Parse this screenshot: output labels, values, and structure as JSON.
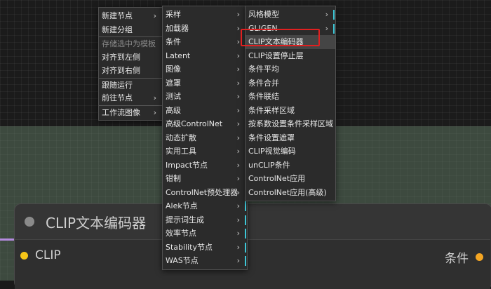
{
  "node": {
    "title": "CLIP文本编码器",
    "input_label": "CLIP",
    "output_label": "条件"
  },
  "menu_main": {
    "items": [
      {
        "label": "新建节点",
        "arrow": "›",
        "bar": false,
        "disabled": false,
        "sep": false
      },
      {
        "label": "新建分组",
        "arrow": "",
        "bar": false,
        "disabled": false,
        "sep": false
      },
      {
        "label": "存储选中为模板",
        "arrow": "",
        "bar": false,
        "disabled": true,
        "sep": true
      },
      {
        "label": "对齐到左侧",
        "arrow": "",
        "bar": false,
        "disabled": false,
        "sep": false
      },
      {
        "label": "对齐到右侧",
        "arrow": "",
        "bar": false,
        "disabled": false,
        "sep": false
      },
      {
        "label": "跟随运行",
        "arrow": "",
        "bar": false,
        "disabled": false,
        "sep": true
      },
      {
        "label": "前往节点",
        "arrow": "›",
        "bar": false,
        "disabled": false,
        "sep": false
      },
      {
        "label": "工作流图像",
        "arrow": "›",
        "bar": false,
        "disabled": false,
        "sep": true
      }
    ]
  },
  "menu_categories": {
    "items": [
      {
        "label": "采样",
        "arrow": "›",
        "bar": true
      },
      {
        "label": "加载器",
        "arrow": "›",
        "bar": true
      },
      {
        "label": "条件",
        "arrow": "›",
        "bar": true
      },
      {
        "label": "Latent",
        "arrow": "›",
        "bar": true
      },
      {
        "label": "图像",
        "arrow": "›",
        "bar": true
      },
      {
        "label": "遮罩",
        "arrow": "›",
        "bar": true
      },
      {
        "label": "测试",
        "arrow": "›",
        "bar": true
      },
      {
        "label": "高级",
        "arrow": "›",
        "bar": true
      },
      {
        "label": "高级ControlNet",
        "arrow": "›",
        "bar": true
      },
      {
        "label": "动态扩散",
        "arrow": "›",
        "bar": true
      },
      {
        "label": "实用工具",
        "arrow": "›",
        "bar": true
      },
      {
        "label": "Impact节点",
        "arrow": "›",
        "bar": true
      },
      {
        "label": "钳制",
        "arrow": "›",
        "bar": true
      },
      {
        "label": "ControlNet预处理器",
        "arrow": "›",
        "bar": true
      },
      {
        "label": "Alek节点",
        "arrow": "›",
        "bar": true
      },
      {
        "label": "提示词生成",
        "arrow": "›",
        "bar": true
      },
      {
        "label": "效率节点",
        "arrow": "›",
        "bar": true
      },
      {
        "label": "Stability节点",
        "arrow": "›",
        "bar": true
      },
      {
        "label": "WAS节点",
        "arrow": "›",
        "bar": true
      }
    ]
  },
  "menu_conditioning": {
    "items": [
      {
        "label": "风格模型",
        "arrow": "›",
        "bar": true
      },
      {
        "label": "GLIGEN",
        "arrow": "›",
        "bar": true
      },
      {
        "label": "CLIP文本编码器",
        "arrow": "",
        "bar": false,
        "highlight": true
      },
      {
        "label": "CLIP设置停止层",
        "arrow": "",
        "bar": false
      },
      {
        "label": "条件平均",
        "arrow": "",
        "bar": false
      },
      {
        "label": "条件合并",
        "arrow": "",
        "bar": false
      },
      {
        "label": "条件联结",
        "arrow": "",
        "bar": false
      },
      {
        "label": "条件采样区域",
        "arrow": "",
        "bar": false
      },
      {
        "label": "按系数设置条件采样区域",
        "arrow": "",
        "bar": false
      },
      {
        "label": "条件设置遮罩",
        "arrow": "",
        "bar": false
      },
      {
        "label": "CLIP视觉编码",
        "arrow": "",
        "bar": false
      },
      {
        "label": "unCLIP条件",
        "arrow": "",
        "bar": false
      },
      {
        "label": "ControlNet应用",
        "arrow": "",
        "bar": false
      },
      {
        "label": "ControlNet应用(高级)",
        "arrow": "",
        "bar": false
      }
    ]
  },
  "colors": {
    "accent_bar": "#3ec6d6",
    "highlight_box": "#e02020",
    "input_pin": "#f5c518",
    "output_pin": "#f5a623"
  }
}
